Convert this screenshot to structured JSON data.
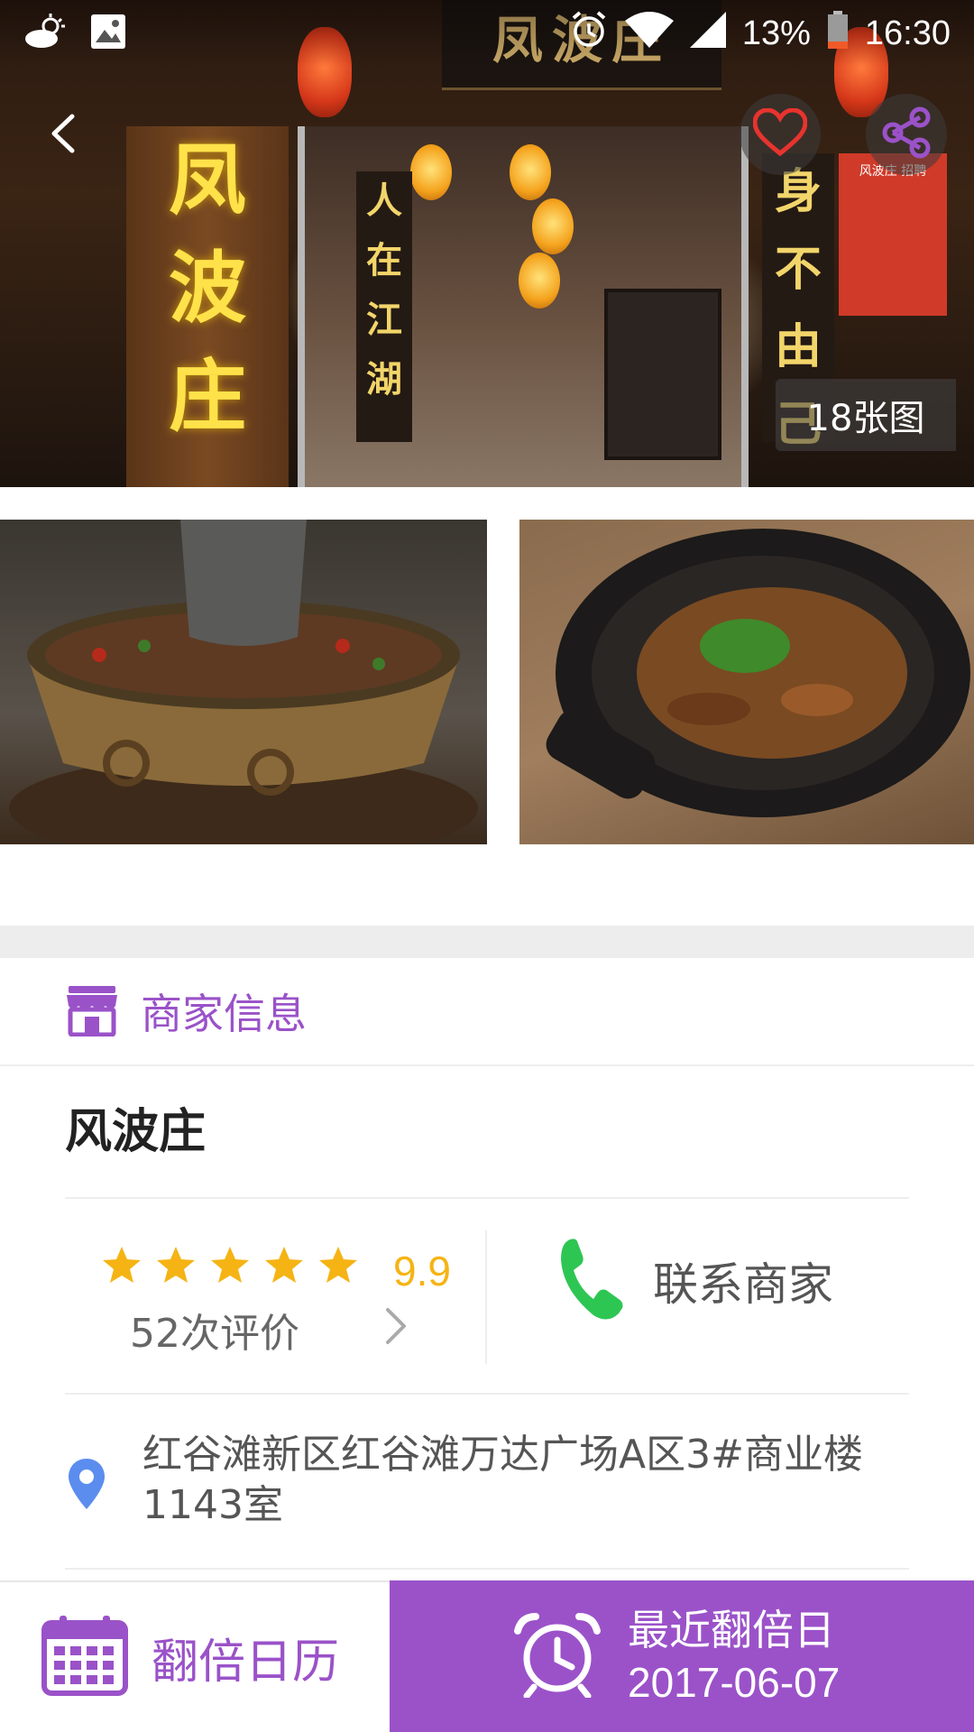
{
  "status_bar": {
    "battery": "13%",
    "time": "16:30",
    "icons": [
      "weather-cloudy-sun-icon",
      "gallery-icon",
      "alarm-icon",
      "wifi-icon",
      "signal-icon",
      "battery-icon"
    ]
  },
  "hero": {
    "photo_count": "18张图",
    "sign_top": "凤波庄",
    "pillar_chars": [
      "凤",
      "波",
      "庄"
    ],
    "banner_left": "人在江湖",
    "banner_right": "身不由己",
    "poster_text": "风波庄 招聘"
  },
  "section": {
    "title": "商家信息",
    "icon": "store-icon"
  },
  "shop": {
    "name": "风波庄",
    "rating_stars": 5,
    "rating_score": "9.9",
    "review_count": "52次评价",
    "contact_label": "联系商家",
    "address": "红谷滩新区红谷滩万达广场A区3#商业楼1143室"
  },
  "bottom_bar": {
    "calendar_label": "翻倍日历",
    "recent_title": "最近翻倍日",
    "recent_date": "2017-06-07"
  },
  "colors": {
    "accent_purple": "#9b52c9",
    "star_yellow": "#f5b414",
    "phone_green": "#2dc653",
    "location_blue": "#5b8def",
    "heart_red": "#e8332e"
  }
}
